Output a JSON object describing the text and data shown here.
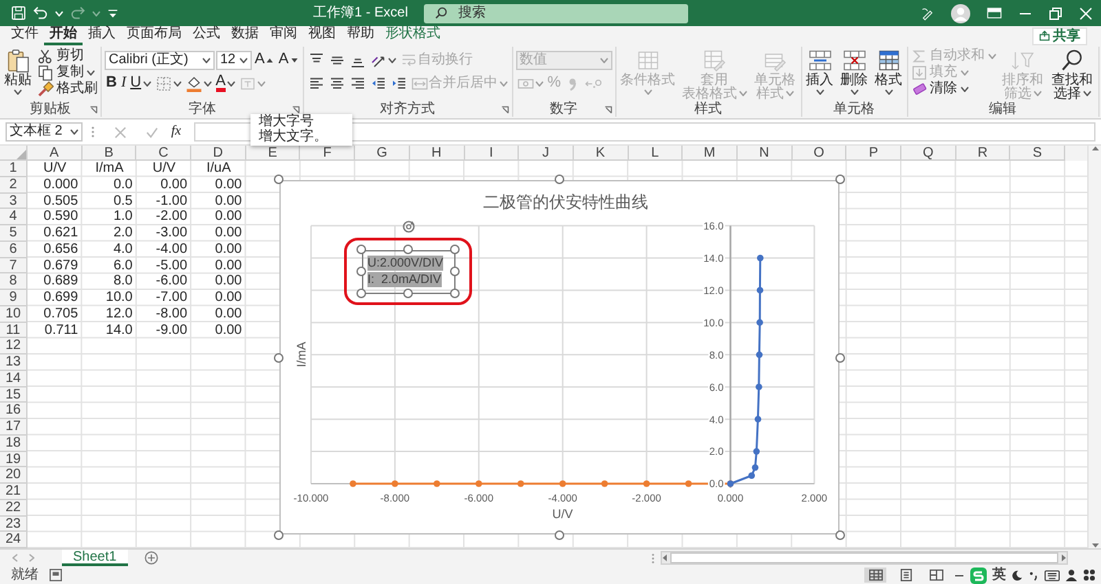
{
  "title_bar": {
    "title": "工作簿1 - Excel",
    "search": {
      "placeholder": "搜索"
    }
  },
  "ribbon_tabs": [
    {
      "label": "文件",
      "selected": false,
      "kind": "plain"
    },
    {
      "label": "开始",
      "selected": true,
      "kind": "plain"
    },
    {
      "label": "插入",
      "selected": false,
      "kind": "plain"
    },
    {
      "label": "页面布局",
      "selected": false,
      "kind": "plain"
    },
    {
      "label": "公式",
      "selected": false,
      "kind": "plain"
    },
    {
      "label": "数据",
      "selected": false,
      "kind": "plain"
    },
    {
      "label": "审阅",
      "selected": false,
      "kind": "plain"
    },
    {
      "label": "视图",
      "selected": false,
      "kind": "plain"
    },
    {
      "label": "帮助",
      "selected": false,
      "kind": "plain"
    },
    {
      "label": "形状格式",
      "selected": false,
      "kind": "contextual"
    }
  ],
  "share_button": {
    "label": "共享"
  },
  "ribbon_groups": [
    {
      "label": "剪贴板",
      "launcher": true,
      "items": [
        [
          {
            "kind": "large",
            "label": "粘贴",
            "dropdown": true,
            "disabled": false
          }
        ],
        [
          {
            "kind": "small",
            "label": "剪切",
            "dropdown": false,
            "disabled": false
          },
          {
            "kind": "small",
            "label": "复制",
            "dropdown": true,
            "disabled": false
          },
          {
            "kind": "small",
            "label": "格式刷",
            "dropdown": false,
            "disabled": false
          }
        ]
      ]
    },
    {
      "label": "字体",
      "launcher": true,
      "items": [
        [
          {
            "kind": "combo",
            "value": "Calibri (正文)",
            "dropdown": true,
            "disabled": false
          },
          {
            "kind": "combo",
            "value": "12",
            "dropdown": true,
            "disabled": false
          },
          {
            "kind": "tool",
            "label": "A",
            "dropdown": false,
            "disabled": false
          },
          {
            "kind": "tool",
            "label": "A",
            "dropdown": false,
            "disabled": false
          }
        ],
        [
          {
            "kind": "tool",
            "label": "B",
            "dropdown": false,
            "disabled": false
          },
          {
            "kind": "tool",
            "label": "I",
            "dropdown": false,
            "disabled": false
          },
          {
            "kind": "tool",
            "label": "U",
            "dropdown": true,
            "disabled": false
          },
          {
            "kind": "tool",
            "dropdown": true,
            "disabled": false
          },
          {
            "kind": "tool",
            "dropdown": true,
            "disabled": false
          },
          {
            "kind": "tool",
            "label": "A",
            "dropdown": true,
            "disabled": false
          },
          {
            "kind": "tool",
            "dropdown": true,
            "disabled": true
          }
        ]
      ]
    },
    {
      "label": "对齐方式",
      "launcher": true,
      "items": [
        [
          {
            "kind": "tool",
            "dropdown": false,
            "disabled": false
          },
          {
            "kind": "tool",
            "dropdown": false,
            "disabled": false
          },
          {
            "kind": "tool",
            "dropdown": false,
            "disabled": false
          },
          {
            "kind": "tool",
            "dropdown": true,
            "disabled": false
          },
          {
            "kind": "tool",
            "label": "自动换行",
            "dropdown": false,
            "disabled": true
          }
        ],
        [
          {
            "kind": "tool",
            "dropdown": false,
            "disabled": false
          },
          {
            "kind": "tool",
            "dropdown": false,
            "disabled": false
          },
          {
            "kind": "tool",
            "dropdown": false,
            "disabled": false
          },
          {
            "kind": "tool",
            "dropdown": false,
            "disabled": false
          },
          {
            "kind": "tool",
            "dropdown": false,
            "disabled": false
          },
          {
            "kind": "tool",
            "label": "合并后居中",
            "dropdown": true,
            "disabled": true
          }
        ]
      ]
    },
    {
      "label": "数字",
      "launcher": true,
      "items": [
        [
          {
            "kind": "combo",
            "value": "数值",
            "dropdown": true,
            "disabled": true
          }
        ],
        [
          {
            "kind": "tool",
            "dropdown": true,
            "disabled": true
          },
          {
            "kind": "tool",
            "label": "%",
            "dropdown": false,
            "disabled": true
          },
          {
            "kind": "tool",
            "dropdown": false,
            "disabled": true
          },
          {
            "kind": "tool",
            "dropdown": false,
            "disabled": true
          }
        ]
      ]
    },
    {
      "label": "样式",
      "launcher": false,
      "items": [
        [
          {
            "kind": "large",
            "label": "条件格式",
            "dropdown": true,
            "disabled": true
          }
        ],
        [
          {
            "kind": "large",
            "label_lines": [
              "套用",
              "表格格式"
            ],
            "dropdown": true,
            "disabled": true
          }
        ],
        [
          {
            "kind": "large",
            "label": "单元格样式",
            "dropdown": true,
            "disabled": true
          }
        ]
      ]
    },
    {
      "label": "单元格",
      "launcher": false,
      "items": [
        [
          {
            "kind": "large",
            "label": "插入",
            "dropdown": true,
            "disabled": false
          }
        ],
        [
          {
            "kind": "large",
            "label": "删除",
            "dropdown": true,
            "disabled": false
          }
        ],
        [
          {
            "kind": "large",
            "label": "格式",
            "dropdown": true,
            "disabled": false
          }
        ]
      ]
    },
    {
      "label": "编辑",
      "launcher": false,
      "items": [
        [
          {
            "kind": "small",
            "label": "自动求和",
            "dropdown": true,
            "disabled": true
          },
          {
            "kind": "small",
            "label": "填充",
            "dropdown": true,
            "disabled": true
          },
          {
            "kind": "small",
            "label": "清除",
            "dropdown": true,
            "disabled": false
          }
        ],
        [
          {
            "kind": "large",
            "label": "排序和筛选",
            "dropdown": true,
            "disabled": true
          }
        ],
        [
          {
            "kind": "large",
            "label": "查找和选择",
            "dropdown": true,
            "disabled": false
          }
        ]
      ]
    }
  ],
  "formula_bar": {
    "name_box": "文本框 2",
    "function_button": "fx"
  },
  "tooltip": {
    "title": "增大字号",
    "text": "增大文字。"
  },
  "sheet": {
    "column_headers": [
      "A",
      "B",
      "C",
      "D",
      "E",
      "F",
      "G",
      "H",
      "I",
      "J",
      "K",
      "L",
      "M",
      "N",
      "O",
      "P",
      "Q",
      "R",
      "S"
    ],
    "row_headers": [
      "1",
      "2",
      "3",
      "4",
      "5",
      "6",
      "7",
      "8",
      "9",
      "10",
      "11",
      "12",
      "13",
      "14",
      "15",
      "16",
      "17",
      "18",
      "19",
      "20",
      "21",
      "22",
      "23",
      "24"
    ],
    "rows": [
      [
        "U/V",
        "I/mA",
        "U/V",
        "I/uA"
      ],
      [
        "0.000",
        "0.0",
        "0.00",
        "0.00"
      ],
      [
        "0.505",
        "0.5",
        "-1.00",
        "0.00"
      ],
      [
        "0.590",
        "1.0",
        "-2.00",
        "0.00"
      ],
      [
        "0.621",
        "2.0",
        "-3.00",
        "0.00"
      ],
      [
        "0.656",
        "4.0",
        "-4.00",
        "0.00"
      ],
      [
        "0.679",
        "6.0",
        "-5.00",
        "0.00"
      ],
      [
        "0.689",
        "8.0",
        "-6.00",
        "0.00"
      ],
      [
        "0.699",
        "10.0",
        "-7.00",
        "0.00"
      ],
      [
        "0.705",
        "12.0",
        "-8.00",
        "0.00"
      ],
      [
        "0.711",
        "14.0",
        "-9.00",
        "0.00"
      ]
    ]
  },
  "chart": {
    "selected": true,
    "chart_data": {
      "type": "line",
      "title": "二极管的伏安特性曲线",
      "xlabel": "U/V",
      "ylabel": "I/mA",
      "grid": true,
      "series": [
        {
          "color": "#4472c4",
          "marker": true,
          "x": [
            0.0,
            0.505,
            0.59,
            0.621,
            0.656,
            0.679,
            0.689,
            0.699,
            0.705,
            0.711
          ],
          "values": [
            0,
            0.5,
            1,
            2,
            4,
            6,
            8,
            10,
            12,
            14
          ]
        },
        {
          "color": "#ed7d31",
          "marker": true,
          "x": [
            0,
            -1,
            -2,
            -3,
            -4,
            -5,
            -6,
            -7,
            -8,
            -9
          ],
          "values": [
            0,
            0,
            0,
            0,
            0,
            0,
            0,
            0,
            0,
            0
          ]
        }
      ],
      "xlim": [
        -10,
        2
      ],
      "ylim": [
        0,
        16
      ],
      "xticks": [
        {
          "value": -10,
          "label": "-10.000"
        },
        {
          "value": -8,
          "label": "-8.000"
        },
        {
          "value": -6,
          "label": "-6.000"
        },
        {
          "value": -4,
          "label": "-4.000"
        },
        {
          "value": -2,
          "label": "-2.000"
        },
        {
          "value": 0,
          "label": "0.000"
        },
        {
          "value": 2,
          "label": "2.000"
        }
      ],
      "yticks": [
        {
          "value": 0,
          "label": "0.0"
        },
        {
          "value": 2,
          "label": "2.0"
        },
        {
          "value": 4,
          "label": "4.0"
        },
        {
          "value": 6,
          "label": "6.0"
        },
        {
          "value": 8,
          "label": "8.0"
        },
        {
          "value": 10,
          "label": "10.0"
        },
        {
          "value": 12,
          "label": "12.0"
        },
        {
          "value": 14,
          "label": "14.0"
        },
        {
          "value": 16,
          "label": "16.0"
        }
      ]
    },
    "text_box": {
      "lines": [
        "U:2.000V/DIV",
        "I:  2.0mA/DIV"
      ],
      "selected": true,
      "text_selected": true
    }
  },
  "sheet_tabs": [
    {
      "label": "Sheet1",
      "selected": true
    }
  ],
  "status_bar": {
    "text": "就绪",
    "view_buttons": [
      {
        "selected": true
      },
      {
        "selected": false
      },
      {
        "selected": false
      }
    ],
    "ime_indicator": "英"
  }
}
